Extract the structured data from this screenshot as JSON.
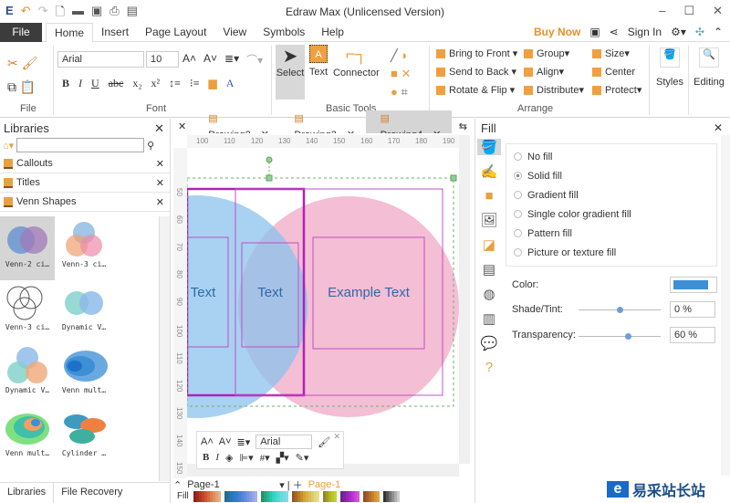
{
  "window": {
    "title": "Edraw Max (Unlicensed Version)",
    "minimize": "–",
    "maximize": "☐",
    "close": "✕"
  },
  "menu": {
    "file": "File",
    "tabs": [
      "Home",
      "Insert",
      "Page Layout",
      "View",
      "Symbols",
      "Help"
    ],
    "buy_now": "Buy Now",
    "sign_in": "Sign In"
  },
  "ribbon": {
    "groups": {
      "file": "File",
      "font": "Font",
      "basic_tools": "Basic Tools",
      "arrange": "Arrange"
    },
    "font_name": "Arial",
    "font_size": "10",
    "select": "Select",
    "text": "Text",
    "connector": "Connector",
    "arrange": [
      "Bring to Front",
      "Send to Back",
      "Rotate & Flip",
      "Group",
      "Align",
      "Distribute",
      "Size",
      "Center",
      "Protect"
    ],
    "styles": "Styles",
    "editing": "Editing"
  },
  "libraries": {
    "title": "Libraries",
    "search_placeholder": "",
    "sections": [
      "Callouts",
      "Titles",
      "Venn Shapes"
    ],
    "shapes": [
      "Venn-2 ci…",
      "Venn-3 ci…",
      "Venn-3 ci…",
      "Dynamic V…",
      "Dynamic V…",
      "Venn mult…",
      "Venn mult…",
      "Cylinder …"
    ],
    "bottom_tabs": [
      "Libraries",
      "File Recovery"
    ]
  },
  "documents": {
    "tabs": [
      "Drawing2",
      "Drawing3",
      "Drawing4"
    ],
    "active": "Drawing4"
  },
  "ruler": {
    "h": [
      "100",
      "110",
      "120",
      "130",
      "140",
      "150",
      "160",
      "170",
      "180",
      "190"
    ],
    "v": [
      "50",
      "60",
      "70",
      "80",
      "90",
      "100",
      "110",
      "120",
      "130",
      "140",
      "150"
    ]
  },
  "canvas": {
    "labels": [
      "Text",
      "Text",
      "Example Text"
    ]
  },
  "mini_toolbar": {
    "font": "Arial"
  },
  "pages": {
    "current": "Page-1",
    "tab": "Page-1",
    "fill_label": "Fill"
  },
  "fill": {
    "title": "Fill",
    "options": [
      "No fill",
      "Solid fill",
      "Gradient fill",
      "Single color gradient fill",
      "Pattern fill",
      "Picture or texture fill"
    ],
    "selected": "Solid fill",
    "color_label": "Color:",
    "color": "#3d8fd6",
    "shade_label": "Shade/Tint:",
    "shade_value": "0 %",
    "shade": 0.5,
    "transparency_label": "Transparency:",
    "transparency_value": "60 %",
    "transparency": 0.6
  },
  "watermark": "易采站长站"
}
